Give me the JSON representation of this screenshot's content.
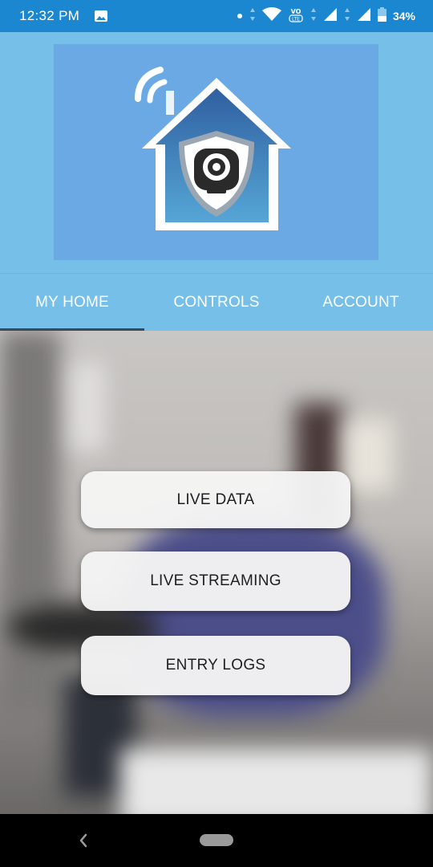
{
  "status_bar": {
    "time": "12:32 PM",
    "battery_percent": "34%",
    "icons": [
      "photo-icon",
      "dot-icon",
      "wifi-icon",
      "volte-icon",
      "signal-icon",
      "signal-icon",
      "battery-icon"
    ]
  },
  "header": {
    "logo": "home-security-camera-logo"
  },
  "tabs": [
    {
      "label": "MY HOME",
      "active": true
    },
    {
      "label": "CONTROLS",
      "active": false
    },
    {
      "label": "ACCOUNT",
      "active": false
    }
  ],
  "actions": {
    "live_data": "LIVE DATA",
    "live_streaming": "LIVE STREAMING",
    "entry_logs": "ENTRY LOGS"
  },
  "colors": {
    "status_bar": "#1b87d0",
    "header_bg": "#75bfe8",
    "logo_bg": "#6aa9e3",
    "tab_indicator": "#3a4a5a"
  }
}
